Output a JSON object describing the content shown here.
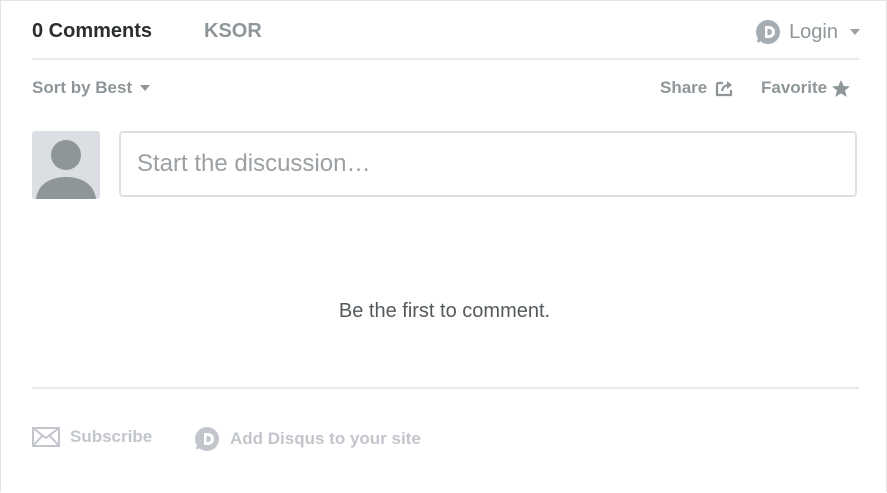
{
  "nav": {
    "comments_tab": "0 Comments",
    "site_tab": "KSOR",
    "login_label": "Login"
  },
  "toolbar": {
    "sort_label": "Sort by Best",
    "share_label": "Share",
    "favorite_label": "Favorite"
  },
  "composer": {
    "placeholder": "Start the discussion…",
    "value": ""
  },
  "empty_state": {
    "message": "Be the first to comment."
  },
  "footer": {
    "subscribe_label": "Subscribe",
    "add_disqus_label": "Add Disqus to your site"
  },
  "icons": {
    "login": "disqus-logo-icon",
    "share": "share-icon",
    "favorite": "star-icon",
    "subscribe": "envelope-icon",
    "add_disqus": "disqus-logo-icon"
  },
  "colors": {
    "active_text": "#2a2e2e",
    "muted_text": "#8e969a",
    "faint_text": "#c2c6cc",
    "border": "#dbdfe4"
  }
}
